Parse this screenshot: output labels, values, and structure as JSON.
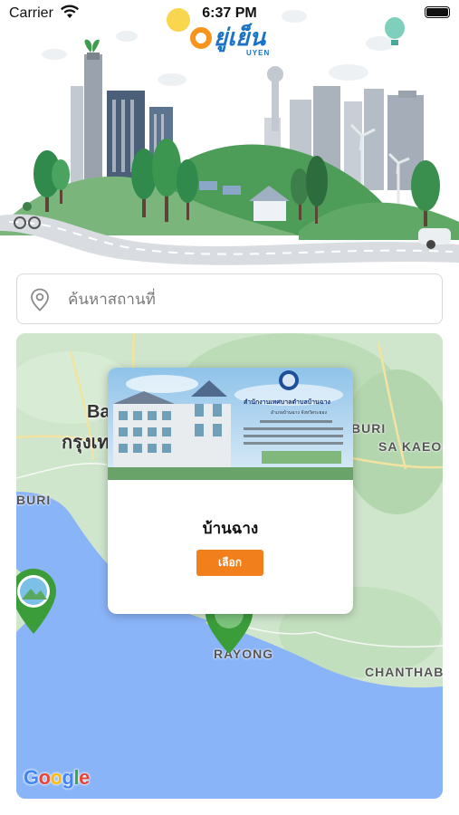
{
  "status_bar": {
    "carrier": "Carrier",
    "time": "6:37 PM"
  },
  "app": {
    "logo_text": "ยู่เย็น",
    "logo_sub": "UYEN"
  },
  "search": {
    "placeholder": "ค้นหาสถานที่",
    "value": ""
  },
  "map": {
    "labels": {
      "bangkok_en": "Ba",
      "bangkok_th": "กรุงเท",
      "buri_top": "BURI",
      "sa_kaeo": "SA KAEO",
      "buri_left": "BURI",
      "rayong": "RAYONG",
      "chanthaburi": "CHANTHAB"
    },
    "attribution": [
      "G",
      "o",
      "o",
      "g",
      "l",
      "e"
    ],
    "attribution_colors": [
      "#4285F4",
      "#EA4335",
      "#FBBC05",
      "#4285F4",
      "#34A853",
      "#EA4335"
    ]
  },
  "popup": {
    "banner_title": "สำนักงานเทศบาลตำบลบ้านฉาง",
    "banner_sub": "อำเภอบ้านฉาง จังหวัดระยอง",
    "place_name": "บ้านฉาง",
    "select_label": "เลือก"
  },
  "colors": {
    "accent_orange": "#f07f1c",
    "pin_green": "#3a9d3a",
    "sea_blue": "#8ab4f8",
    "land_green": "#cfe5cc"
  }
}
